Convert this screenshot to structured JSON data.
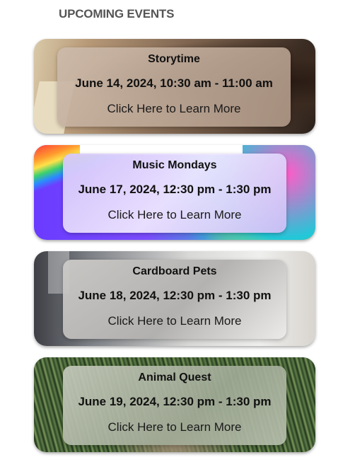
{
  "section": {
    "title": "UPCOMING EVENTS"
  },
  "events": [
    {
      "title": "Storytime",
      "date": "June 14, 2024, 10:30 am - 11:00 am",
      "link": "Click Here to Learn More"
    },
    {
      "title": "Music Mondays",
      "date": "June 17, 2024, 12:30 pm - 1:30 pm",
      "link": "Click Here to Learn More"
    },
    {
      "title": "Cardboard Pets",
      "date": "June 18, 2024, 12:30 pm - 1:30 pm",
      "link": "Click Here to Learn More"
    },
    {
      "title": "Animal Quest",
      "date": "June 19, 2024, 12:30 pm - 1:30 pm",
      "link": "Click Here to Learn More"
    }
  ]
}
